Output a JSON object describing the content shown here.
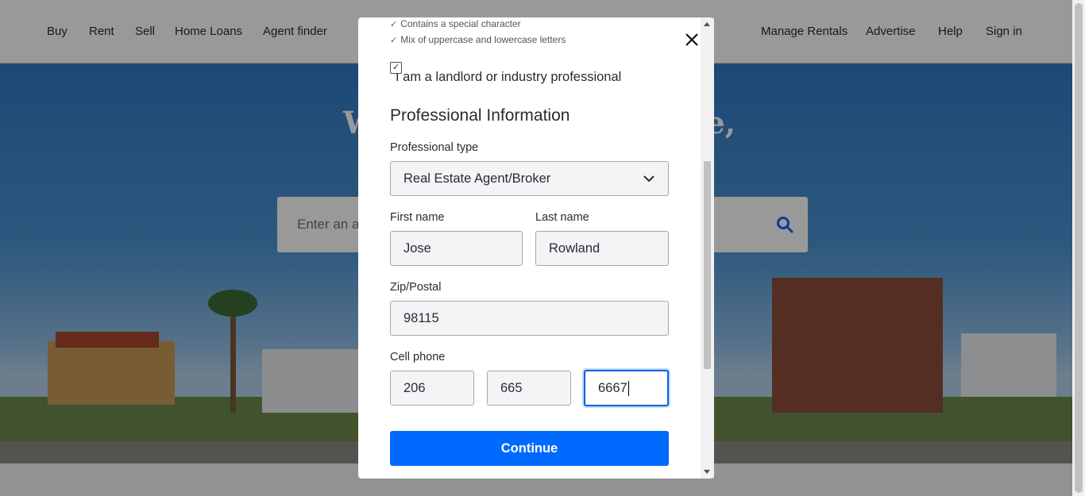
{
  "nav": {
    "left": [
      "Buy",
      "Rent",
      "Sell",
      "Home Loans",
      "Agent finder"
    ],
    "right": [
      "Manage Rentals",
      "Advertise",
      "Help",
      "Sign in"
    ]
  },
  "hero": {
    "title_left": "W",
    "title_right": "ge,",
    "search_placeholder": "Enter an a"
  },
  "modal": {
    "requirements": [
      "Contains a special character",
      "Mix of uppercase and lowercase letters"
    ],
    "landlord_checkbox": {
      "label": "I am a landlord or industry professional",
      "checked": true
    },
    "section_title": "Professional Information",
    "professional_type": {
      "label": "Professional type",
      "value": "Real Estate Agent/Broker"
    },
    "first_name": {
      "label": "First name",
      "value": "Jose"
    },
    "last_name": {
      "label": "Last name",
      "value": "Rowland"
    },
    "zip": {
      "label": "Zip/Postal",
      "value": "98115"
    },
    "cell_phone": {
      "label": "Cell phone",
      "area": "206",
      "prefix": "665",
      "line": "6667"
    },
    "continue_label": "Continue"
  },
  "colors": {
    "accent": "#006aff",
    "check": "#0d8a3a",
    "text": "#2a2a33"
  },
  "icons": [
    "check-icon",
    "close-icon",
    "chevron-down-icon",
    "search-icon"
  ]
}
